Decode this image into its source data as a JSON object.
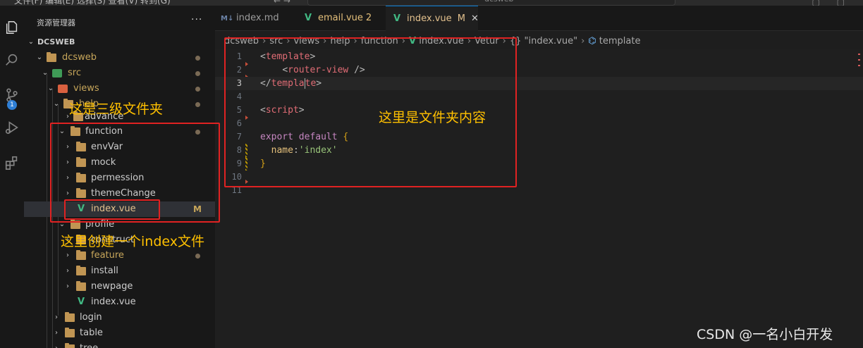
{
  "titlebar": {
    "menu": "文件(F)  编辑(E)  选择(S)  查看(V)  转到(G)",
    "nav": "←  →",
    "command_center": "dcsweb"
  },
  "activity_bar": {
    "items": [
      "explorer-icon",
      "search-icon",
      "source-control-icon",
      "run-debug-icon",
      "extensions-icon"
    ],
    "scm_badge": "1"
  },
  "sidebar": {
    "title": "资源管理器",
    "more": "···",
    "tree": [
      {
        "label": "DCSWEB",
        "kind": "root"
      },
      {
        "label": "dcsweb",
        "kind": "folder",
        "open": true
      },
      {
        "label": "src",
        "kind": "folder",
        "open": true
      },
      {
        "label": "views",
        "kind": "folder",
        "open": true
      },
      {
        "label": "help",
        "kind": "folder",
        "open": true
      },
      {
        "label": "advance",
        "kind": "folder",
        "open": false
      },
      {
        "label": "function",
        "kind": "folder",
        "open": true
      },
      {
        "label": "envVar",
        "kind": "folder",
        "open": false
      },
      {
        "label": "mock",
        "kind": "folder",
        "open": false
      },
      {
        "label": "permession",
        "kind": "folder",
        "open": false
      },
      {
        "label": "themeChange",
        "kind": "folder",
        "open": false
      },
      {
        "label": "index.vue",
        "kind": "vue",
        "status": "M"
      },
      {
        "label": "profile",
        "kind": "folder",
        "open": true
      },
      {
        "label": "construct",
        "kind": "folder",
        "open": false
      },
      {
        "label": "feature",
        "kind": "folder",
        "open": false
      },
      {
        "label": "install",
        "kind": "folder",
        "open": false
      },
      {
        "label": "newpage",
        "kind": "folder",
        "open": false
      },
      {
        "label": "index.vue",
        "kind": "vue"
      },
      {
        "label": "login",
        "kind": "folder",
        "open": false
      },
      {
        "label": "table",
        "kind": "folder",
        "open": false
      },
      {
        "label": "tree",
        "kind": "folder",
        "open": false
      }
    ]
  },
  "tabs": [
    {
      "label": "index.md",
      "icon": "markdown-icon"
    },
    {
      "label": "email.vue",
      "count": "2",
      "icon": "vue-icon"
    },
    {
      "label": "index.vue",
      "status": "M",
      "icon": "vue-icon",
      "active": true
    }
  ],
  "breadcrumbs": [
    "dcsweb",
    "src",
    "views",
    "help",
    "function",
    "index.vue",
    "Vetur",
    "{} \"index.vue\"",
    "template"
  ],
  "code_lines": [
    {
      "n": "1",
      "text": "<template>"
    },
    {
      "n": "2",
      "text": "    <router-view />"
    },
    {
      "n": "3",
      "text": "</template>"
    },
    {
      "n": "4",
      "text": ""
    },
    {
      "n": "5",
      "text": "<script>"
    },
    {
      "n": "6",
      "text": ""
    },
    {
      "n": "7",
      "text": "export default {"
    },
    {
      "n": "8",
      "text": "  name:'index'"
    },
    {
      "n": "9",
      "text": "}"
    },
    {
      "n": "10",
      "text": ""
    },
    {
      "n": "11",
      "text": ""
    }
  ],
  "annotations": {
    "third_level_folder": "这是三级文件夹",
    "create_index_file": "这里创建一个index文件",
    "folder_content": "这里是文件夹内容"
  },
  "watermark": "CSDN @一名小白开发",
  "colors": {
    "vue_green": "#41b883",
    "folder_gold": "#c09553",
    "annotation_red": "#e02222",
    "annotation_text": "#ffc000",
    "tab_accent": "#0078d4"
  }
}
